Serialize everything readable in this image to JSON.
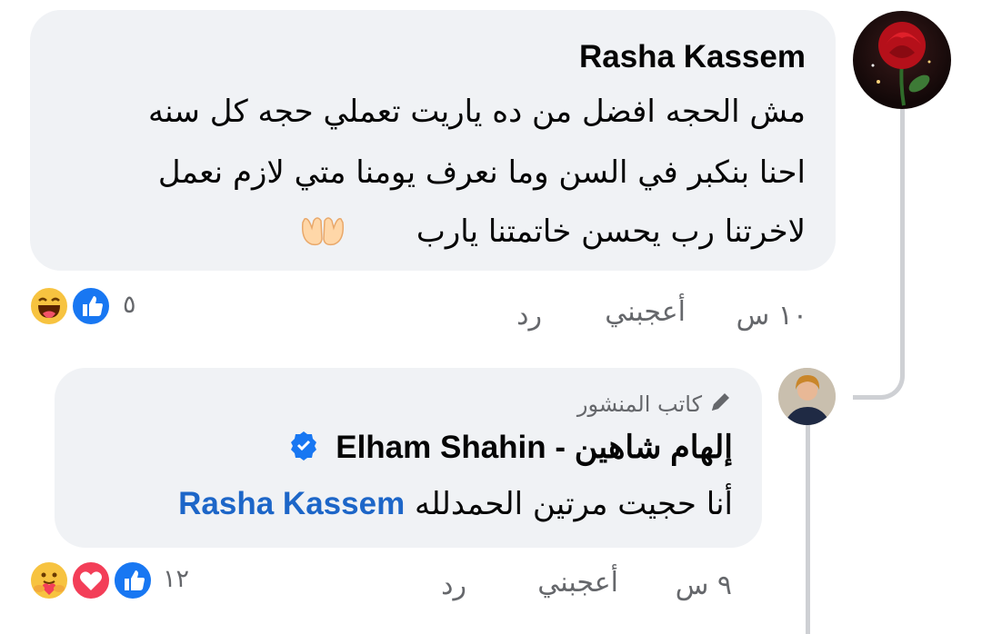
{
  "comment": {
    "author": "Rasha Kassem",
    "text_lines": [
      "مش الحجه افضل من ده ياريت تعملي حجه كل سنه",
      "احنا بنكبر في السن وما نعرف يومنا متي لازم نعمل",
      "لاخرتنا رب يحسن خاتمتنا يارب"
    ],
    "emoji_icon": "praying-hands-icon",
    "time": "١٠ س",
    "like_label": "أعجبني",
    "reply_label": "رد",
    "reaction_count": "٥",
    "reactions": [
      "haha-icon",
      "like-icon"
    ]
  },
  "reply": {
    "badge": "كاتب المنشور",
    "author": "إلهام شاهين - Elham Shahin",
    "verified_icon": "verified-badge-icon",
    "mention": "Rasha Kassem",
    "text": "أنا حجيت مرتين  الحمدلله",
    "time": "٩ س",
    "like_label": "أعجبني",
    "reply_label": "رد",
    "reaction_count": "١٢",
    "reactions": [
      "care-icon",
      "love-icon",
      "like-icon"
    ]
  },
  "colors": {
    "bubble": "#f0f2f5",
    "meta_text": "#65676b",
    "mention": "#1d66c8",
    "like_blue": "#1877f2",
    "love_red": "#f33e58",
    "thread_line": "#ced0d4"
  }
}
